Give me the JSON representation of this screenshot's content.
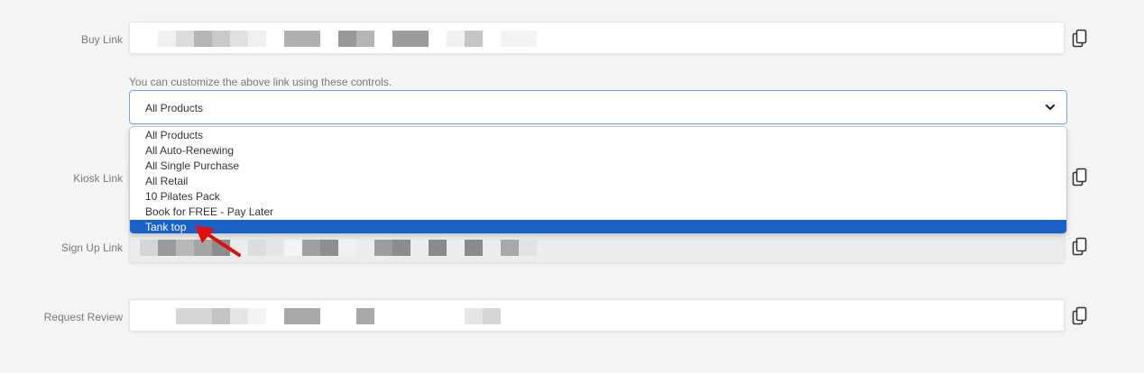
{
  "rows": {
    "buy": {
      "label": "Buy Link"
    },
    "kiosk": {
      "label": "Kiosk Link"
    },
    "signup": {
      "label": "Sign Up Link"
    },
    "review": {
      "label": "Request Review"
    }
  },
  "customize": {
    "hint": "You can customize the above link using these controls.",
    "selected": "All Products",
    "options": [
      "All Products",
      "All Auto-Renewing",
      "All Single Purchase",
      "All Retail",
      "10 Pilates Pack",
      "Book for FREE - Pay Later",
      "Tank top"
    ],
    "highlighted_option": "Tank top"
  },
  "icons": {
    "copy": "copy-icon",
    "chevron": "chevron-down-icon",
    "annotation": "red-arrow-icon"
  },
  "colors": {
    "accent": "#1862c9",
    "focus_border": "#6fa3de",
    "annotation_arrow": "#e01010"
  }
}
